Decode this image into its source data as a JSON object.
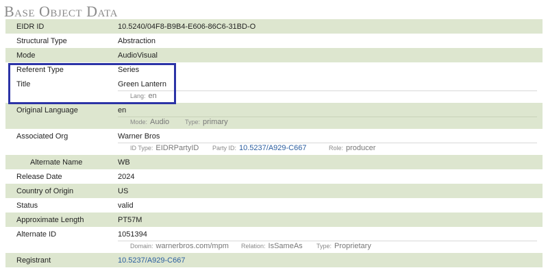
{
  "section": {
    "title": "Base Object Data"
  },
  "rows": {
    "eidr_id": {
      "label": "EIDR ID",
      "value": "10.5240/04F8-B9B4-E606-86C6-31BD-O"
    },
    "structural_type": {
      "label": "Structural Type",
      "value": "Abstraction"
    },
    "mode": {
      "label": "Mode",
      "value": "AudioVisual"
    },
    "referent_type": {
      "label": "Referent Type",
      "value": "Series"
    },
    "title": {
      "label": "Title",
      "value": "Green Lantern",
      "lang_key": "Lang:",
      "lang_value": "en"
    },
    "original_language": {
      "label": "Original Language",
      "value": "en",
      "mode_key": "Mode:",
      "mode_value": "Audio",
      "type_key": "Type:",
      "type_value": "primary"
    },
    "associated_org": {
      "label": "Associated Org",
      "value": "Warner Bros",
      "idtype_key": "ID Type:",
      "idtype_value": "EIDRPartyID",
      "partyid_key": "Party ID:",
      "partyid_value": "10.5237/A929-C667",
      "role_key": "Role:",
      "role_value": "producer"
    },
    "alternate_name": {
      "label": "Alternate Name",
      "value": "WB"
    },
    "release_date": {
      "label": "Release Date",
      "value": "2024"
    },
    "country_of_origin": {
      "label": "Country of Origin",
      "value": "US"
    },
    "status": {
      "label": "Status",
      "value": "valid"
    },
    "approximate_length": {
      "label": "Approximate Length",
      "value": "PT57M"
    },
    "alternate_id": {
      "label": "Alternate ID",
      "value": "1051394",
      "domain_key": "Domain:",
      "domain_value": "warnerbros.com/mpm",
      "relation_key": "Relation:",
      "relation_value": "IsSameAs",
      "type_key": "Type:",
      "type_value": "Proprietary"
    },
    "registrant": {
      "label": "Registrant",
      "value": "10.5237/A929-C667"
    }
  },
  "colors": {
    "row_alt": "#dde6cf",
    "link": "#2a5d9f",
    "highlight_border": "#2b33a6",
    "title": "#8a8a8a"
  }
}
